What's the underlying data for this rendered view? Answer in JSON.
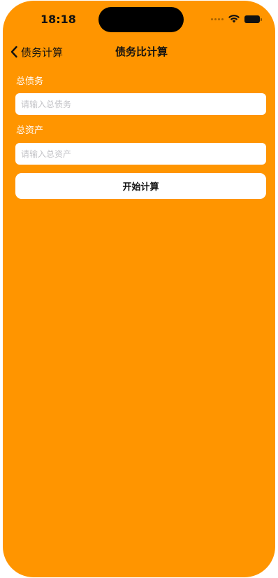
{
  "status_bar": {
    "time": "18:18",
    "icons": [
      "signal-dots-icon",
      "wifi-icon",
      "battery-icon"
    ]
  },
  "nav": {
    "back_label": "债务计算",
    "title": "债务比计算"
  },
  "form": {
    "total_debt_label": "总债务",
    "total_debt_placeholder": "请输入总债务",
    "total_debt_value": "",
    "total_assets_label": "总资产",
    "total_assets_placeholder": "请输入总资产",
    "total_assets_value": "",
    "submit_label": "开始计算"
  },
  "colors": {
    "background": "#FF9500",
    "input_background": "#FFFFFF",
    "label_text": "#FFFFFF"
  }
}
